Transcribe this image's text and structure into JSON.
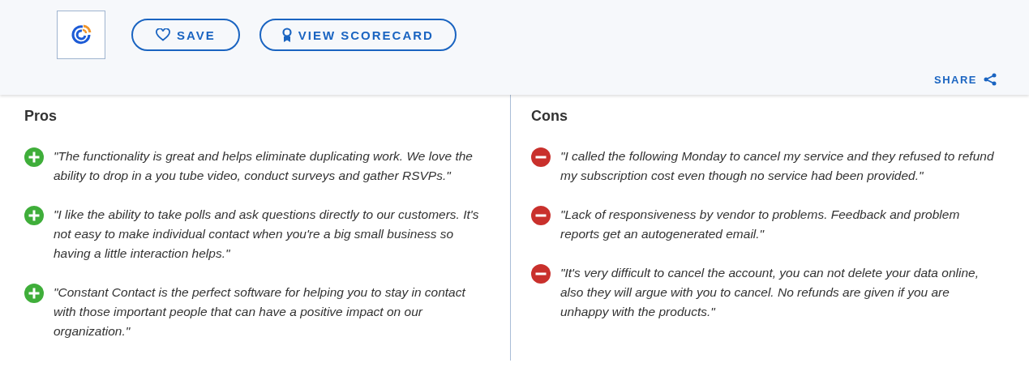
{
  "header": {
    "buttons": [
      {
        "kind": "save",
        "label": "SAVE"
      },
      {
        "kind": "scorecard",
        "label": "VIEW SCORECARD"
      }
    ],
    "share": {
      "label": "SHARE"
    }
  },
  "sections": [
    {
      "kind": "pros",
      "title": "Pros",
      "items": [
        "\"The functionality is great and helps eliminate duplicating work. We love the ability to drop in a you tube video, conduct surveys and gather RSVPs.\"",
        "\"I like the ability to take polls and ask questions directly to our customers. It's not easy to make individual contact when you're a big small business so having a little interaction helps.\"",
        "\"Constant Contact is the perfect software for helping you to stay in contact with those important people that can have a positive impact on our organization.\""
      ]
    },
    {
      "kind": "cons",
      "title": "Cons",
      "items": [
        "\"I called the following Monday to cancel my service and they refused to refund my subscription cost even though no service had been provided.\"",
        "\"Lack of responsiveness by vendor to problems. Feedback and problem reports get an autogenerated email.\"",
        "\"It's very difficult to cancel the account, you can not delete your data online, also they will argue with you to cancel. No refunds are given if you are unhappy with the products.\""
      ]
    }
  ]
}
